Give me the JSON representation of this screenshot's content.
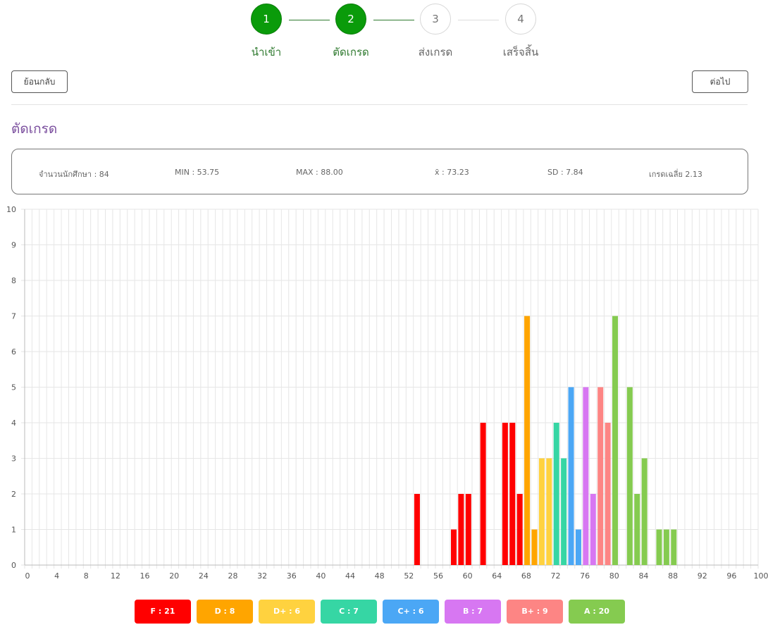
{
  "stepper": {
    "steps": [
      {
        "number": "1",
        "label": "นำเข้า",
        "state": "done"
      },
      {
        "number": "2",
        "label": "ตัดเกรด",
        "state": "done"
      },
      {
        "number": "3",
        "label": "ส่งเกรด",
        "state": "pending"
      },
      {
        "number": "4",
        "label": "เสร็จสิ้น",
        "state": "pending"
      }
    ]
  },
  "nav": {
    "back_label": "ย้อนกลับ",
    "next_label": "ต่อไป"
  },
  "page_title": "ตัดเกรด",
  "stats": {
    "students": "จำนวนนักศึกษา : 84",
    "min": "MIN : 53.75",
    "max": "MAX : 88.00",
    "mean": "x̄ : 73.23",
    "sd": "SD : 7.84",
    "gpa": "เกรดเฉลี่ย 2.13"
  },
  "chart_data": {
    "type": "bar",
    "xlim": [
      0,
      100
    ],
    "ylim": [
      0,
      10
    ],
    "x_ticks": [
      0,
      4,
      8,
      12,
      16,
      20,
      24,
      28,
      32,
      36,
      40,
      44,
      48,
      52,
      56,
      60,
      64,
      68,
      72,
      76,
      80,
      84,
      88,
      92,
      96,
      100
    ],
    "y_ticks": [
      0,
      1,
      2,
      3,
      4,
      5,
      6,
      7,
      8,
      9,
      10
    ],
    "grid": true,
    "legend_position": "bottom",
    "grades": [
      {
        "grade": "F",
        "label": "F : 21",
        "color": "#ff0000",
        "bars": [
          {
            "x": 53,
            "y": 2
          },
          {
            "x": 58,
            "y": 1
          },
          {
            "x": 59,
            "y": 2
          },
          {
            "x": 60,
            "y": 2
          },
          {
            "x": 62,
            "y": 4
          },
          {
            "x": 65,
            "y": 4
          },
          {
            "x": 66,
            "y": 4
          },
          {
            "x": 67,
            "y": 2
          }
        ]
      },
      {
        "grade": "D",
        "label": "D : 8",
        "color": "#ffa500",
        "bars": [
          {
            "x": 68,
            "y": 7
          },
          {
            "x": 69,
            "y": 1
          }
        ]
      },
      {
        "grade": "D+",
        "label": "D+ : 6",
        "color": "#ffd23f",
        "bars": [
          {
            "x": 70,
            "y": 3
          },
          {
            "x": 71,
            "y": 3
          }
        ]
      },
      {
        "grade": "C",
        "label": "C : 7",
        "color": "#36d6a4",
        "bars": [
          {
            "x": 72,
            "y": 4
          },
          {
            "x": 73,
            "y": 3
          }
        ]
      },
      {
        "grade": "C+",
        "label": "C+ : 6",
        "color": "#4ba7f5",
        "bars": [
          {
            "x": 74,
            "y": 5
          },
          {
            "x": 75,
            "y": 1
          }
        ]
      },
      {
        "grade": "B",
        "label": "B : 7",
        "color": "#d777f2",
        "bars": [
          {
            "x": 76,
            "y": 5
          },
          {
            "x": 77,
            "y": 2
          }
        ]
      },
      {
        "grade": "B+",
        "label": "B+ : 9",
        "color": "#fd8584",
        "bars": [
          {
            "x": 78,
            "y": 5
          },
          {
            "x": 79,
            "y": 4
          }
        ]
      },
      {
        "grade": "A",
        "label": "A : 20",
        "color": "#85cb50",
        "bars": [
          {
            "x": 80,
            "y": 7
          },
          {
            "x": 82,
            "y": 5
          },
          {
            "x": 83,
            "y": 2
          },
          {
            "x": 84,
            "y": 3
          },
          {
            "x": 86,
            "y": 1
          },
          {
            "x": 87,
            "y": 1
          },
          {
            "x": 88,
            "y": 1
          }
        ]
      }
    ]
  }
}
